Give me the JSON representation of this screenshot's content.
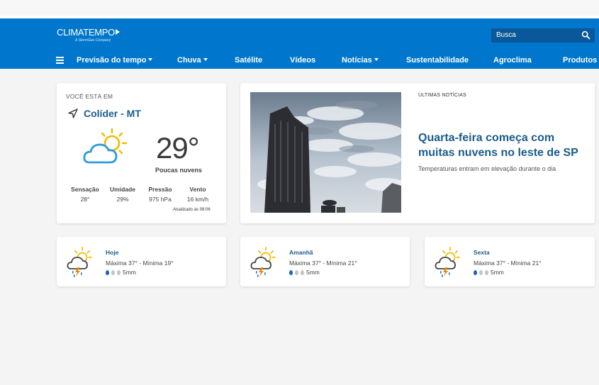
{
  "header": {
    "logo": "CLIMATEMPO",
    "logo_sub": "A StormGeo Company",
    "search_placeholder": "Busca"
  },
  "nav": {
    "menu_icon": "hamburger-menu-icon",
    "items": [
      {
        "label": "Previsão do tempo",
        "dropdown": true
      },
      {
        "label": "Chuva",
        "dropdown": true
      },
      {
        "label": "Satélite",
        "dropdown": false
      },
      {
        "label": "Vídeos",
        "dropdown": false
      },
      {
        "label": "Notícias",
        "dropdown": true
      },
      {
        "label": "Sustentabilidade",
        "dropdown": false
      },
      {
        "label": "Agroclima",
        "dropdown": false
      },
      {
        "label": "Produtos",
        "dropdown": false
      }
    ]
  },
  "location": {
    "label": "VOCÊ ESTÁ EM",
    "city": "Colíder - MT",
    "icon": "partly-cloudy-icon",
    "temperature": "29°",
    "condition": "Poucas nuvens",
    "metrics": [
      {
        "label": "Sensação",
        "value": "28°"
      },
      {
        "label": "Umidade",
        "value": "29%"
      },
      {
        "label": "Pressão",
        "value": "975 hPa"
      },
      {
        "label": "Vento",
        "value": "16 km/h"
      }
    ],
    "updated": "Atualizado às 08:06"
  },
  "news": {
    "kicker": "ÚLTIMAS NOTÍCIAS",
    "title": "Quarta-feira começa com muitas nuvens no leste de SP",
    "subtitle": "Temperaturas entram em elevação durante o dia",
    "image": "city-sky-photo"
  },
  "forecast": [
    {
      "day": "Hoje",
      "minmax": "Máxima 37° - Mínima 19°",
      "rain": "5mm",
      "rain_level": 1,
      "icon": "sun-storm-icon"
    },
    {
      "day": "Amanhã",
      "minmax": "Máxima 37° - Mínima 21°",
      "rain": "5mm",
      "rain_level": 1,
      "icon": "sun-storm-icon"
    },
    {
      "day": "Sexta",
      "minmax": "Máxima 37° - Mínima 21°",
      "rain": "5mm",
      "rain_level": 1,
      "icon": "sun-storm-icon"
    }
  ],
  "colors": {
    "header": "#0077cc",
    "accent_text": "#1a5c8c",
    "sun": "#f5b800",
    "rain_drop": "#1565c0",
    "background": "#f4f4f4"
  }
}
